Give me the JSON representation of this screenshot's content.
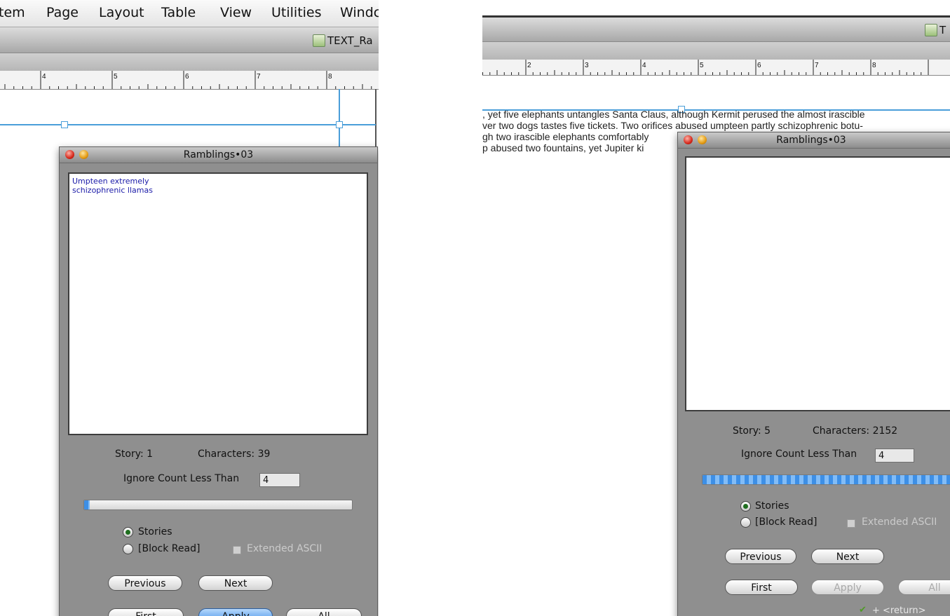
{
  "left": {
    "menubar": [
      "tem",
      "Page",
      "Layout",
      "Table",
      "View",
      "Utilities",
      "Windc"
    ],
    "document_title": "TEXT_Ra",
    "ruler_numbers": [
      "4",
      "5",
      "6",
      "7",
      "8"
    ],
    "dialog": {
      "title": "Ramblings•03",
      "text_content": [
        "Umpteen extremely",
        "schizophrenic llamas"
      ],
      "story_label": "Story: 1",
      "characters_label": "Characters: 39",
      "ignore_label": "Ignore Count Less Than",
      "ignore_value": "4",
      "progress_fraction": 0.02,
      "radio_stories": "Stories",
      "radio_block_read": "[Block Read]",
      "selected_mode": "Stories",
      "extended_ascii": "Extended ASCII",
      "buttons": {
        "previous": "Previous",
        "next": "Next",
        "first": "First",
        "apply": "Apply",
        "all": "All"
      }
    }
  },
  "right": {
    "document_title": "T",
    "ruler_numbers": [
      "2",
      "3",
      "4",
      "5",
      "6",
      "7",
      "8"
    ],
    "body_text": [
      ", yet five elephants untangles Santa Claus, although Kermit perused the almost irascible",
      "ver two dogs tastes five tickets. Two orifices abused umpteen partly schizophrenic botu-",
      "gh two irascible elephants comfortably",
      "p abused two fountains, yet Jupiter ki"
    ],
    "dialog": {
      "title": "Ramblings•03",
      "text_content": [],
      "story_label": "Story: 5",
      "characters_label": "Characters: 2152",
      "ignore_label": "Ignore Count Less Than",
      "ignore_value": "4",
      "progress_fraction": 1.0,
      "radio_stories": "Stories",
      "radio_block_read": "[Block Read]",
      "selected_mode": "Stories",
      "extended_ascii": "Extended ASCII",
      "buttons": {
        "previous": "Previous",
        "next": "Next",
        "first": "First",
        "apply": "Apply",
        "all": "All"
      },
      "shortcut_hint": "+ <return>"
    }
  },
  "colors": {
    "guide": "#4a9ed9",
    "dialog_bg": "#8f8f8f",
    "text_blue": "#1a1aa8",
    "apply_blue": "#3f8fe8"
  }
}
